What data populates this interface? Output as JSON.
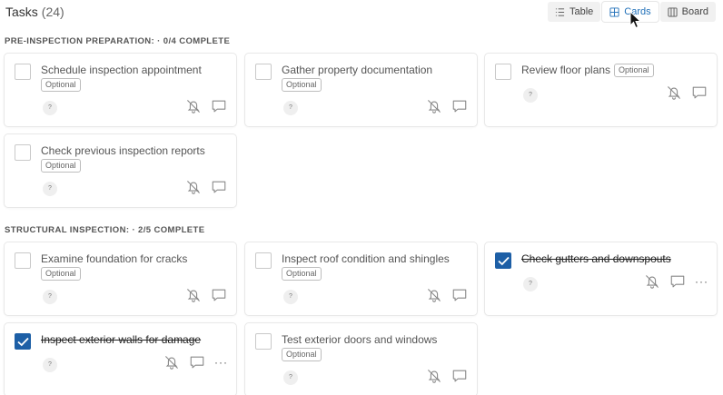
{
  "header": {
    "title": "Tasks",
    "count": "(24)",
    "views": [
      {
        "label": "Table",
        "icon": "list-icon"
      },
      {
        "label": "Cards",
        "icon": "grid-icon",
        "active": true
      },
      {
        "label": "Board",
        "icon": "columns-icon"
      }
    ]
  },
  "sections": [
    {
      "label": "PRE-INSPECTION PREPARATION:",
      "progress": "· 0/4 COMPLETE",
      "cards": [
        {
          "title": "Schedule inspection appointment",
          "badge": "Optional",
          "avatar": "?",
          "checked": false
        },
        {
          "title": "Gather property documentation",
          "badge": "Optional",
          "avatar": "?",
          "checked": false
        },
        {
          "title": "Review floor plans",
          "badge": "Optional",
          "avatar": "?",
          "checked": false
        },
        {
          "title": "Check previous inspection reports",
          "badge": "Optional",
          "avatar": "?",
          "checked": false
        }
      ]
    },
    {
      "label": "STRUCTURAL INSPECTION:",
      "progress": "· 2/5 COMPLETE",
      "cards": [
        {
          "title": "Examine foundation for cracks",
          "badge": "Optional",
          "avatar": "?",
          "checked": false
        },
        {
          "title": "Inspect roof condition and shingles",
          "badge": "Optional",
          "avatar": "?",
          "checked": false
        },
        {
          "title": "Check gutters and downspouts",
          "badge": "",
          "avatar": "?",
          "checked": true,
          "more": "···"
        },
        {
          "title": "Inspect exterior walls for damage",
          "badge": "",
          "avatar": "?",
          "checked": true,
          "more": "···"
        },
        {
          "title": "Test exterior doors and windows",
          "badge": "Optional",
          "avatar": "?",
          "checked": false
        }
      ]
    }
  ],
  "colors": {
    "accent": "#1d5fa6",
    "active_view": "#1f6fb8",
    "border": "#e8e8e8"
  }
}
